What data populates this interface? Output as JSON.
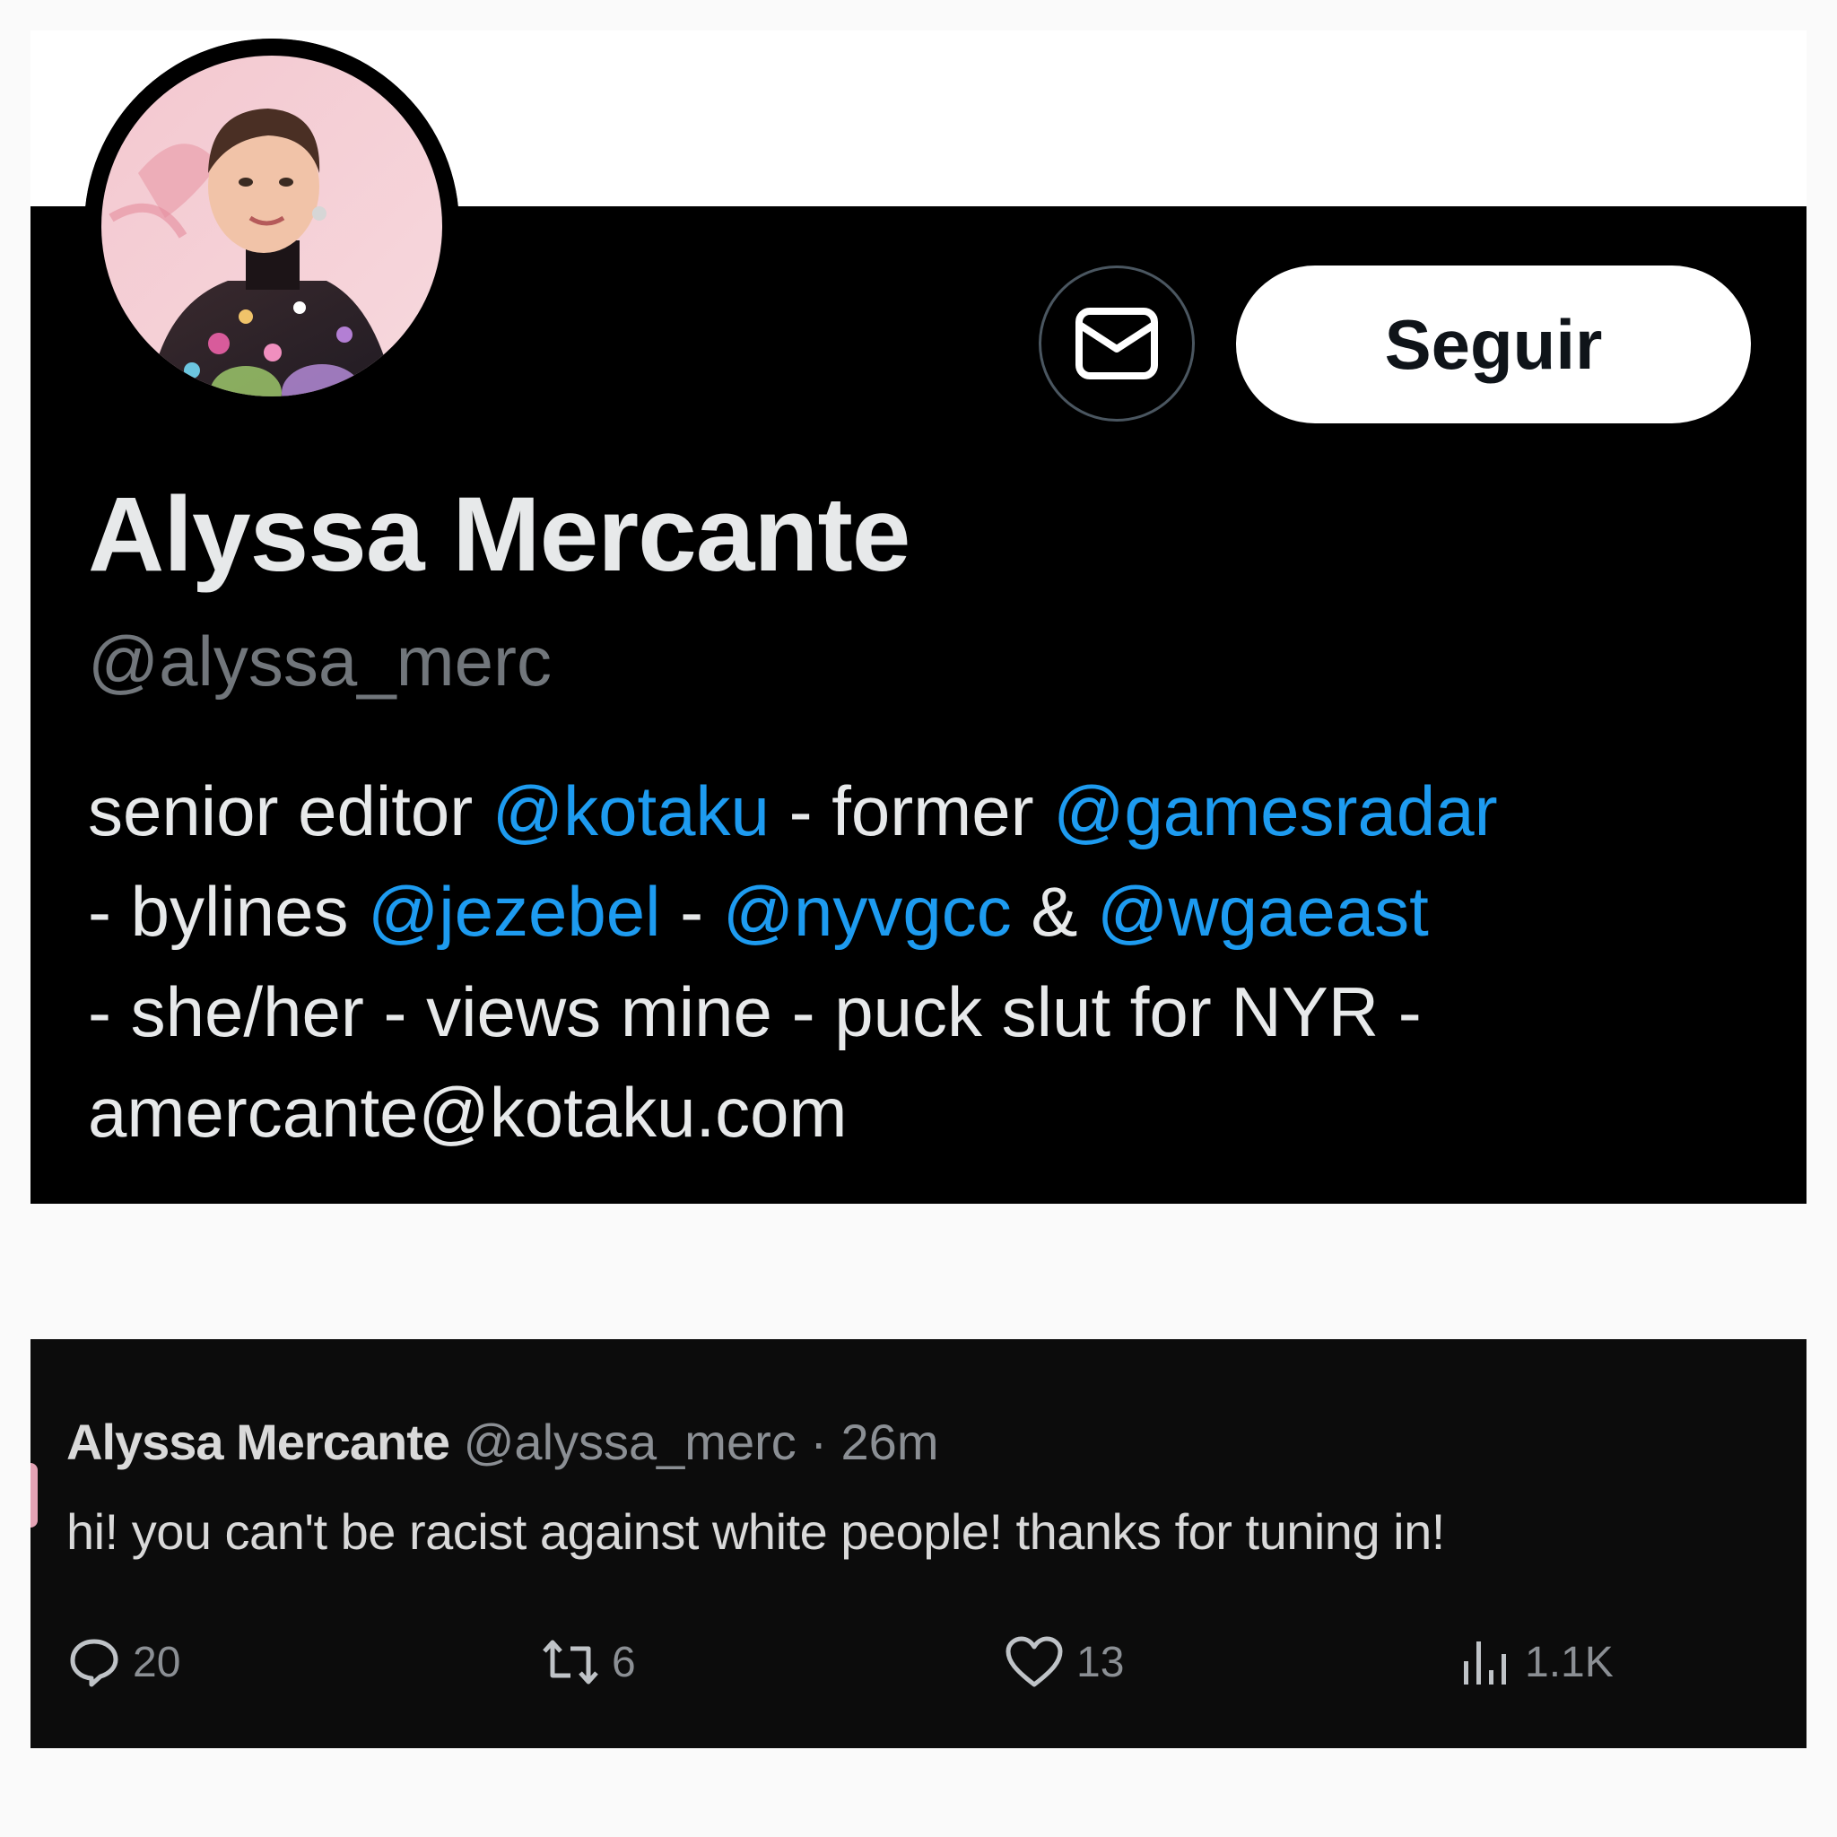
{
  "profile": {
    "display_name": "Alyssa Mercante",
    "handle": "@alyssa_merc",
    "follow_label": "Seguir",
    "dm_icon": "envelope-icon",
    "bio": {
      "line1_a": "senior editor ",
      "line1_mention1": "@kotaku",
      "line1_b": " - former ",
      "line1_mention2": "@gamesradar",
      "line2_a": "- bylines ",
      "line2_mention1": "@jezebel",
      "line2_b": " - ",
      "line2_mention2": "@nyvgcc",
      "line2_c": " & ",
      "line2_mention3": "@wgaeast",
      "line3": "- she/her - views mine - puck slut for NYR -",
      "line4": "amercante@kotaku.com"
    },
    "colors": {
      "background": "#000000",
      "mention": "#1d9bf0",
      "text": "#e7e9ea",
      "muted": "#71767b"
    }
  },
  "tweet": {
    "author": "Alyssa Mercante",
    "handle": "@alyssa_merc",
    "separator": "·",
    "time": "26m",
    "text": "hi! you can't be racist against white people! thanks for tuning in!",
    "actions": {
      "replies": "20",
      "retweets": "6",
      "likes": "13",
      "views": "1.1K"
    },
    "icons": [
      "reply-icon",
      "retweet-icon",
      "like-icon",
      "views-icon"
    ]
  }
}
